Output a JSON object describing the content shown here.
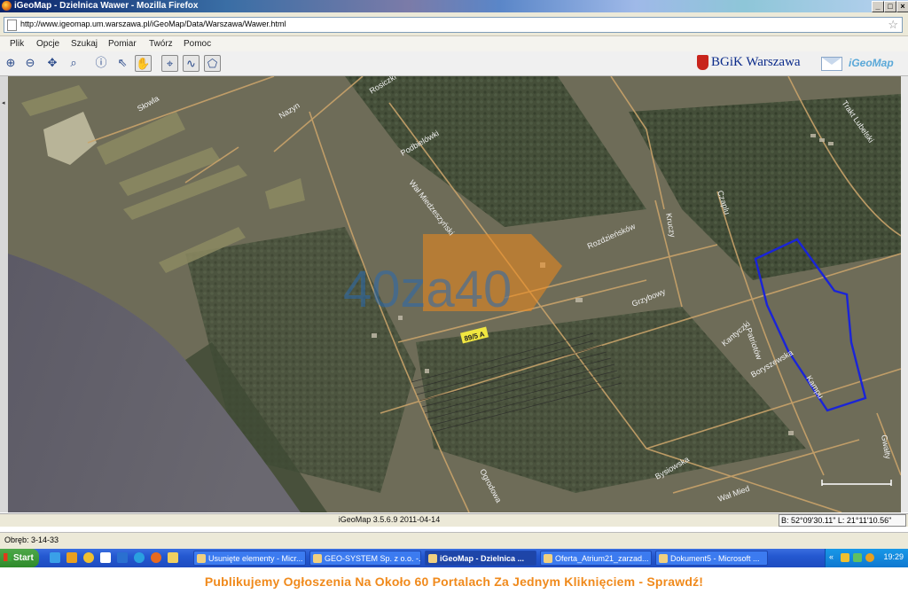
{
  "window": {
    "title": "iGeoMap - Dzielnica Wawer - Mozilla Firefox",
    "buttons": [
      "_",
      "□",
      "×"
    ]
  },
  "browser": {
    "url": "http://www.igeomap.um.warszawa.pl/iGeoMap/Data/Warszawa/Wawer.html",
    "status": "Obręb: 3-14-33"
  },
  "menu": [
    "Plik",
    "Opcje",
    "Szukaj",
    "Pomiar",
    "Twórz",
    "Pomoc"
  ],
  "toolbar": {
    "tools": [
      {
        "name": "zoom-in-icon",
        "glyph": "⊕"
      },
      {
        "name": "zoom-out-icon",
        "glyph": "⊖"
      },
      {
        "name": "pan-icon",
        "glyph": "✥"
      },
      {
        "name": "zoom-area-icon",
        "glyph": "⌕"
      },
      {
        "name": "info-icon",
        "glyph": "ⓘ"
      },
      {
        "name": "select-arrow-icon",
        "glyph": "⇖"
      },
      {
        "name": "hand-icon",
        "glyph": "✋"
      },
      {
        "name": "crosshair-icon",
        "glyph": "⌖"
      },
      {
        "name": "polyline-icon",
        "glyph": "∿"
      },
      {
        "name": "polygon-icon",
        "glyph": "⬠"
      }
    ],
    "brand": "BGiK Warszawa",
    "igeomap": "iGeoMap"
  },
  "map": {
    "watermark": "40za40",
    "parcel_label": "89/5 A",
    "streets": [
      "Słowla",
      "Rosiczki",
      "Nazyn",
      "Podbielówki",
      "Wał Miedzeszyński",
      "Rozdzieńsków",
      "Kruczy",
      "Czaplu",
      "Trakt Lubelski",
      "Grzybowy",
      "Kantyczki",
      "Patriotów",
      "Boryszewska",
      "Ogrodowa",
      "Bysiowska",
      "Wał Mied",
      "Kampu",
      "Gwałty"
    ],
    "accent_polygon": "#1a24d8",
    "accent_watermark": "#f08a1c"
  },
  "statusbar": {
    "version": "iGeoMap 3.5.6.9 2011-04-14",
    "coords": "B: 52°09'30.11\" L: 21°11'10.56\""
  },
  "taskbar": {
    "start": "Start",
    "tasks": [
      {
        "label": "Usunięte elementy - Micr...",
        "active": false
      },
      {
        "label": "GEO-SYSTEM Sp. z o.o. -...",
        "active": false
      },
      {
        "label": "iGeoMap - Dzielnica ...",
        "active": true
      },
      {
        "label": "Oferta_Atrium21_zarzad...",
        "active": false
      },
      {
        "label": "Dokument5 - Microsoft ...",
        "active": false
      }
    ],
    "clock": "19:29"
  },
  "footer": "Publikujemy Ogłoszenia Na Około 60 Portalach Za Jednym Kliknięciem - Sprawdź!"
}
